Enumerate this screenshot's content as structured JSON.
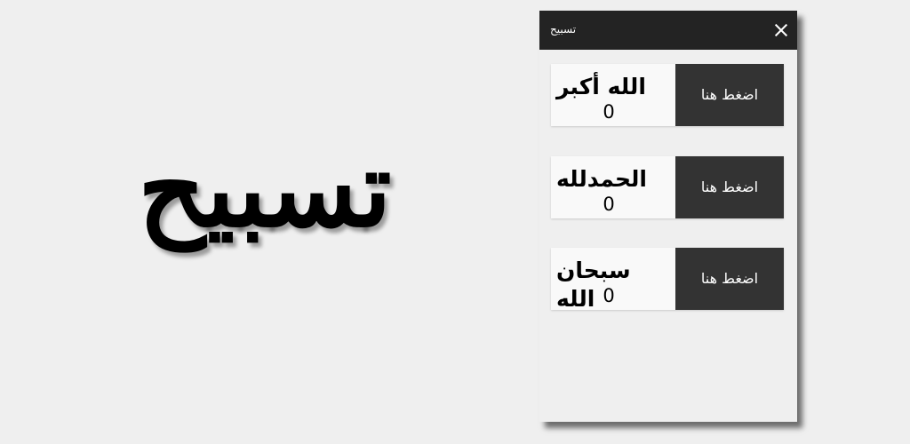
{
  "banner": {
    "title": "تسبيح"
  },
  "app": {
    "title": "تسبيح"
  },
  "counters": [
    {
      "label": "الله أكبر",
      "count": "0",
      "button": "اضغط هنا"
    },
    {
      "label": "الحمدلله",
      "count": "0",
      "button": "اضغط هنا"
    },
    {
      "label": "سبحان الله",
      "count": "0",
      "button": "اضغط هنا"
    }
  ],
  "colors": {
    "background": "#efefef",
    "app_bar": "#232323",
    "button": "#333333",
    "card": "#f9f9f9"
  },
  "icons": {
    "close": "close-icon"
  }
}
